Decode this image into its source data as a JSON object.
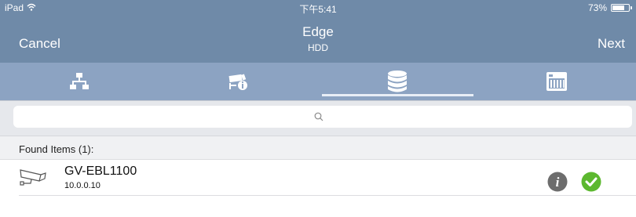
{
  "status_bar": {
    "device": "iPad",
    "time": "下午5:41",
    "battery_percent": "73%",
    "battery_level": 0.73
  },
  "nav": {
    "cancel_label": "Cancel",
    "title": "Edge",
    "subtitle": "HDD",
    "next_label": "Next"
  },
  "tabs": [
    {
      "icon": "network-icon",
      "active": false
    },
    {
      "icon": "camera-info-icon",
      "active": false
    },
    {
      "icon": "database-icon",
      "active": true
    },
    {
      "icon": "device-grid-icon",
      "active": false
    }
  ],
  "search": {
    "value": "",
    "placeholder": ""
  },
  "found": {
    "title": "Found Items (1):",
    "items": [
      {
        "name": "GV-EBL1100",
        "ip": "10.0.0.10",
        "icon": "camera-icon"
      }
    ]
  },
  "colors": {
    "header": "#6f8aa8",
    "tab_bar": "#8ca3c2",
    "check": "#5cb82f",
    "info": "#6d6d6d"
  }
}
